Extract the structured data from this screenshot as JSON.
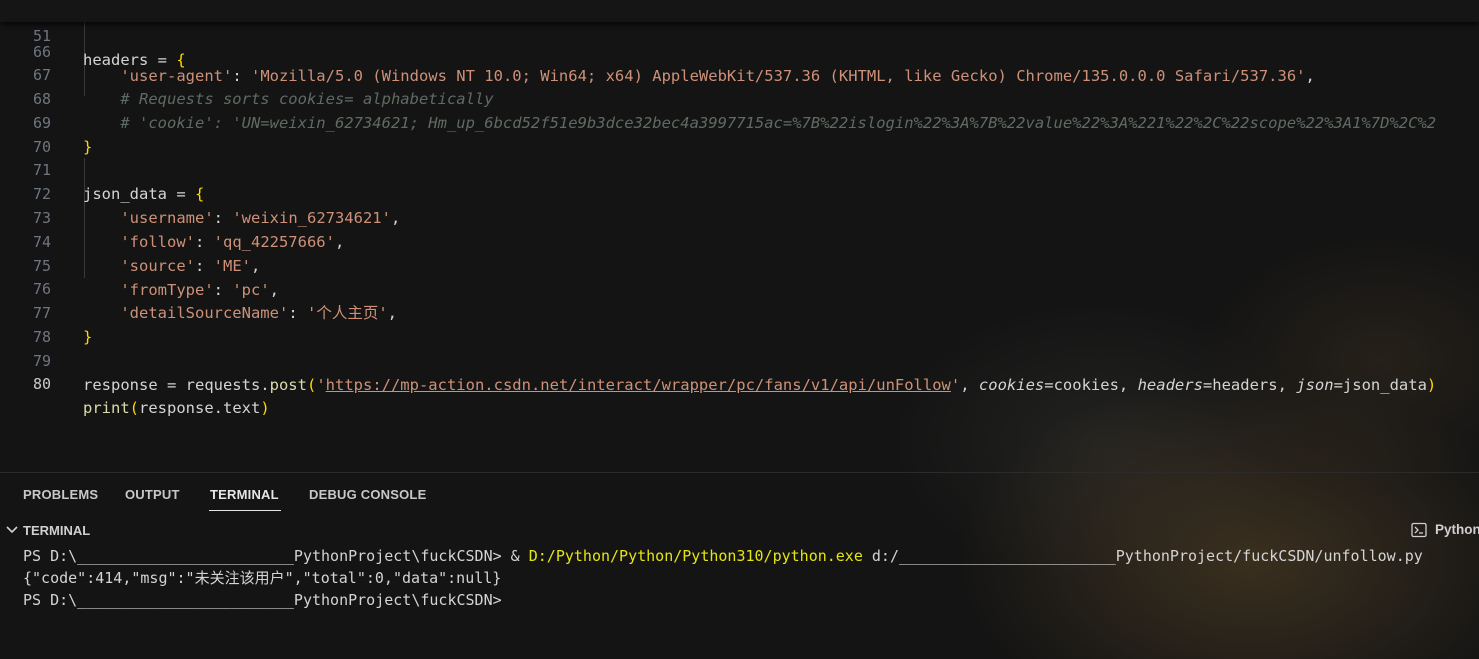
{
  "editor": {
    "sticky": {
      "line_number": "51",
      "code": "headers = {"
    },
    "lines": [
      {
        "n": "66",
        "text": "    'user-agent': 'Mozilla/5.0 (Windows NT 10.0; Win64; x64) AppleWebKit/537.36 (KHTML, like Gecko) Chrome/135.0.0.0 Safari/537.36',"
      },
      {
        "n": "67",
        "text": "    # Requests sorts cookies= alphabetically"
      },
      {
        "n": "68",
        "text": "    # 'cookie': 'UN=weixin_62734621; Hm_up_6bcd52f51e9b3dce32bec4a3997715ac=%7B%22islogin%22%3A%7B%22value%22%3A%221%22%2C%22scope%22%3A1%7D%2C%2"
      },
      {
        "n": "69",
        "text": "}"
      },
      {
        "n": "70",
        "text": ""
      },
      {
        "n": "71",
        "text": "json_data = {"
      },
      {
        "n": "72",
        "key": "'username'",
        "value": "'weixin_62734621'"
      },
      {
        "n": "73",
        "key": "'follow'",
        "value": "'qq_42257666'"
      },
      {
        "n": "74",
        "key": "'source'",
        "value": "'ME'"
      },
      {
        "n": "75",
        "key": "'fromType'",
        "value": "'pc'"
      },
      {
        "n": "76",
        "key": "'detailSourceName'",
        "value": "'个人主页'"
      },
      {
        "n": "77",
        "text": "}"
      },
      {
        "n": "78",
        "text": ""
      },
      {
        "n": "79",
        "prefix": "response = requests.",
        "fn": "post",
        "url": "https://mp-action.csdn.net/interact/wrapper/pc/fans/v1/api/unFollow",
        "args": [
          "cookies",
          "cookies",
          "headers",
          "headers",
          "json",
          "json_data"
        ]
      },
      {
        "n": "80",
        "fn": "print",
        "arg": "response.text"
      }
    ],
    "comment_67": "# Requests sorts cookies= alphabetically",
    "comment_68": "# 'cookie': 'UN=weixin_62734621; Hm_up_6bcd52f51e9b3dce32bec4a3997715ac=%7B%22islogin%22%3A%7B%22value%22%3A%221%22%2C%22scope%22%3A1%7D%2C%2",
    "ua_key": "'user-agent'",
    "ua_value": "'Mozilla/5.0 (Windows NT 10.0; Win64; x64) AppleWebKit/537.36 (KHTML, like Gecko) Chrome/135.0.0.0 Safari/537.36'"
  },
  "panel": {
    "tabs": [
      {
        "label": "PROBLEMS"
      },
      {
        "label": "OUTPUT"
      },
      {
        "label": "TERMINAL"
      },
      {
        "label": "DEBUG CONSOLE"
      }
    ],
    "active_tab": "TERMINAL"
  },
  "terminal": {
    "section_title": "TERMINAL",
    "profile_label": "Python",
    "lines": [
      {
        "prompt": "PS D:\\________________________PythonProject\\fuckCSDN> ",
        "amp": "& ",
        "exe": "D:/Python/Python/Python310/python.exe",
        "rest": " d:/________________________PythonProject/fuckCSDN/unfollow.py"
      },
      {
        "text": "{\"code\":414,\"msg\":\"未关注该用户\",\"total\":0,\"data\":null}"
      },
      {
        "text": "PS D:\\________________________PythonProject\\fuckCSDN>"
      }
    ]
  },
  "colors": {
    "background": "#141414",
    "string": "#ce9178",
    "bracket": "#ffd700",
    "function": "#dcdcaa",
    "comment": "#5f6b62",
    "terminal_exe": "#e5e510"
  }
}
